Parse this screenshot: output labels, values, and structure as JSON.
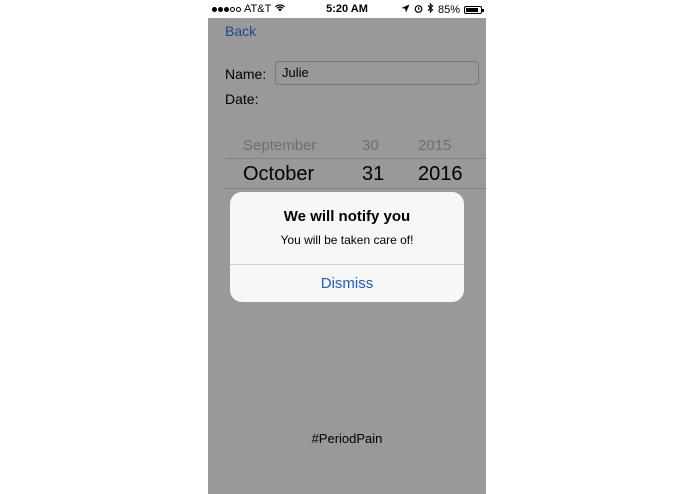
{
  "status_bar": {
    "carrier": "AT&T",
    "time": "5:20 AM",
    "battery": "85%",
    "battery_level": 0.85
  },
  "nav": {
    "back_label": "Back"
  },
  "form": {
    "name_label": "Name:",
    "name_value": "Julie",
    "date_label": "Date:"
  },
  "date_picker": {
    "previous": {
      "month": "September",
      "day": "30",
      "year": "2015"
    },
    "selected": {
      "month": "October",
      "day": "31",
      "year": "2016"
    }
  },
  "footer": {
    "hashtag": "#PeriodPain"
  },
  "alert": {
    "title": "We will notify you",
    "message": "You will be taken care of!",
    "dismiss_label": "Dismiss"
  },
  "colors": {
    "link_blue": "#1a5ad7",
    "dim_overlay": "rgba(0,0,0,0.4)"
  }
}
